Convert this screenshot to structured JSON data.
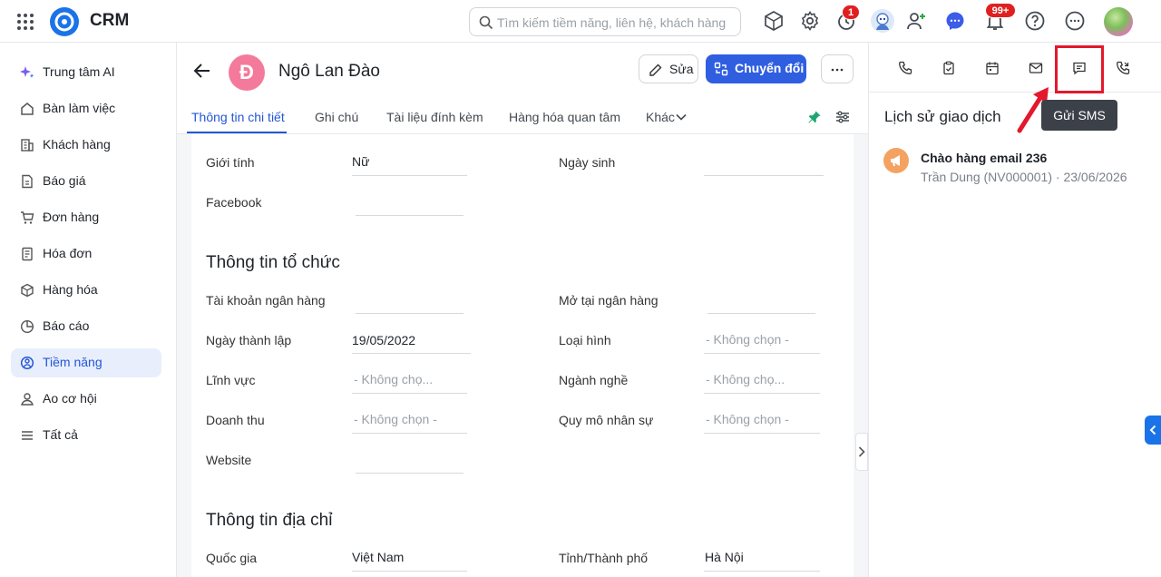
{
  "header": {
    "brand": "CRM",
    "search_placeholder": "Tìm kiếm tiềm năng, liên hệ, khách hàng",
    "timer_badge": "1",
    "notif_badge": "99+"
  },
  "sidebar": {
    "items": [
      {
        "label": "Trung tâm AI",
        "icon": "sparkle-icon"
      },
      {
        "label": "Bàn làm việc",
        "icon": "home-icon"
      },
      {
        "label": "Khách hàng",
        "icon": "building-icon"
      },
      {
        "label": "Báo giá",
        "icon": "quote-icon"
      },
      {
        "label": "Đơn hàng",
        "icon": "cart-icon"
      },
      {
        "label": "Hóa đơn",
        "icon": "invoice-icon"
      },
      {
        "label": "Hàng hóa",
        "icon": "box-icon"
      },
      {
        "label": "Báo cáo",
        "icon": "pie-chart-icon"
      },
      {
        "label": "Tiềm năng",
        "icon": "target-icon",
        "active": true
      },
      {
        "label": "Ao cơ hội",
        "icon": "pool-icon"
      },
      {
        "label": "Tất cả",
        "icon": "menu-icon"
      }
    ]
  },
  "record": {
    "avatar_letter": "Đ",
    "name": "Ngô Lan Đào",
    "edit_label": "Sửa",
    "convert_label": "Chuyển đổi"
  },
  "tabs": [
    "Thông tin chi tiết",
    "Ghi chú",
    "Tài liệu đính kèm",
    "Hàng hóa quan tâm",
    "Khác"
  ],
  "personal": {
    "gender_label": "Giới tính",
    "gender_value": "Nữ",
    "birthday_label": "Ngày sinh",
    "facebook_label": "Facebook"
  },
  "org": {
    "title": "Thông tin tổ chức",
    "bank_account_label": "Tài khoản ngân hàng",
    "bank_at_label": "Mở tại ngân hàng",
    "founded_label": "Ngày thành lập",
    "founded_value": "19/05/2022",
    "type_label": "Loại hình",
    "type_value": "- Không chọn -",
    "field_label": "Lĩnh vực",
    "field_value": "- Không chọ...",
    "industry_label": "Ngành nghề",
    "industry_value": "- Không chọ...",
    "revenue_label": "Doanh thu",
    "revenue_value": "- Không chọn -",
    "size_label": "Quy mô nhân sự",
    "size_value": "- Không chọn -",
    "website_label": "Website"
  },
  "address": {
    "title": "Thông tin địa chỉ",
    "country_label": "Quốc gia",
    "country_value": "Việt Nam",
    "city_label": "Tỉnh/Thành phố",
    "city_value": "Hà Nội"
  },
  "right_panel": {
    "tooltip": "Gửi SMS",
    "history_title": "Lịch sử giao dịch",
    "history": [
      {
        "title": "Chào hàng email 236",
        "meta": "Trần Dung (NV000001) · 23/06/2026"
      }
    ]
  },
  "colors": {
    "accent": "#2f5fe0",
    "highlight": "#e3182d",
    "avatar": "#f47a9c"
  }
}
